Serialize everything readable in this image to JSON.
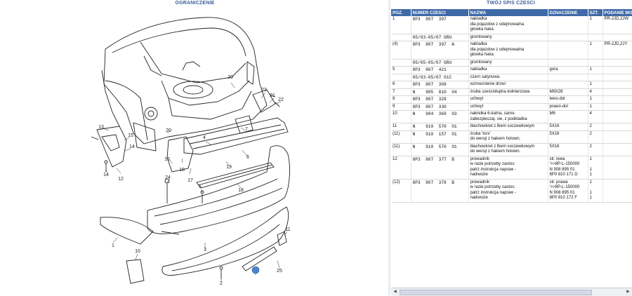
{
  "left_header": "OGRANICZENIE",
  "right_header": "TWÓJ SPIS CZESCI",
  "table": {
    "columns": [
      "POZ.",
      "NUMER CZESCI",
      "NAZWA",
      "DZNACZENIE",
      "SZT.",
      "PODANIE MO"
    ],
    "rows": [
      {
        "poz": "1",
        "num": "8P3  807  397",
        "name": "nakladka\ndla pojazdow z odejmowalna\nglowka haka",
        "dz": "",
        "szt": "1",
        "pod": "PR-2JD,2JW",
        "selected": true
      },
      {
        "poz": "",
        "num": "05/03-05/07 GRU",
        "name": "gruntowany",
        "dz": "",
        "szt": "",
        "pod": ""
      },
      {
        "poz": "(4)",
        "num": "8P3  807  397  A",
        "name": "nakladka\ndla pojazdow z odejmowalna\nglowka haka",
        "dz": "",
        "szt": "1",
        "pod": "PR-2JD,2JY"
      },
      {
        "poz": "",
        "num": "05/05-05/07 GRU",
        "name": "gruntowany",
        "dz": "",
        "szt": "",
        "pod": ""
      },
      {
        "poz": "5",
        "num": "8P3  807  421",
        "name": "nakladka",
        "dz": "gora",
        "szt": "1",
        "pod": ""
      },
      {
        "poz": "",
        "num": "05/03-05/07 01C",
        "name": "czern satynowa",
        "dz": "",
        "szt": "",
        "pod": ""
      },
      {
        "poz": "6",
        "num": "8P3  807  309",
        "name": "wzmocnienie drzwi",
        "dz": "",
        "szt": "1",
        "pod": ""
      },
      {
        "poz": "7",
        "num": "N    905  810  04",
        "name": "śruba sześciokątna kołnierzowa",
        "dz": "M8X28",
        "szt": "4",
        "pod": ""
      },
      {
        "poz": "8",
        "num": "8P3  807  329",
        "name": "uchwyt",
        "dz": "lewo.dol",
        "szt": "1",
        "pod": ""
      },
      {
        "poz": "9",
        "num": "8P3  807  330",
        "name": "uchwyt",
        "dz": "prawo-dol",
        "szt": "1",
        "pod": ""
      },
      {
        "poz": "10",
        "num": "N    904  369  03",
        "name": "nakretka 6-katna, samo-\nzabezpieczaj. sie, z podkladka",
        "dz": "M6",
        "szt": "4",
        "pod": ""
      },
      {
        "poz": "11",
        "num": "N    910  570  01",
        "name": "blachowkret z lbem soczewkowym",
        "dz": "5X16",
        "szt": "2",
        "pod": ""
      },
      {
        "poz": "(11)",
        "num": "N    910  157  01",
        "name": "śruba 'torx'\ndo wersji z hakiem holown.",
        "dz": "5X16",
        "szt": "2",
        "pod": ""
      },
      {
        "poz": "(11)",
        "num": "N    910  570  01",
        "name": "blachowkret z lbem soczewkowym\ndo wersji z hakiem holown.",
        "dz": "5X16",
        "szt": "2",
        "pod": ""
      },
      {
        "poz": "12",
        "num": "8P3  807  377  B",
        "name": "prowadnik\n          w razie potrzeby zastos:\npatrz instrukcja napraw -\nnadwozie",
        "dz": "str. lewa\n'>>8P-L-150000\nN   908 895 01\n8P0 810 171 D",
        "szt": "1\n\n1\n1",
        "pod": ""
      },
      {
        "poz": "(12)",
        "num": "8P3  807  378  B",
        "name": "prowadnik\n          w razie potrzeby zastos:\npatrz instrukcja napraw -\nnadwozie",
        "dz": "str. prawa\n'>>8P-L-150000\nN   908 895 01\n8P0 810 172 F",
        "szt": "1\n\n1\n1",
        "pod": ""
      }
    ]
  },
  "diagram": {
    "callouts": [
      "20",
      "23",
      "21",
      "22",
      "13",
      "20",
      "15",
      "14",
      "4",
      "7",
      "6",
      "16",
      "18",
      "17",
      "12",
      "14",
      "19",
      "5",
      "18",
      "24",
      "1",
      "3",
      "25",
      "10",
      "11",
      "2"
    ]
  },
  "colors": {
    "header_blue": "#3f6aa8",
    "title_blue": "#3b5e9a",
    "highlight": "#4a86c8"
  }
}
